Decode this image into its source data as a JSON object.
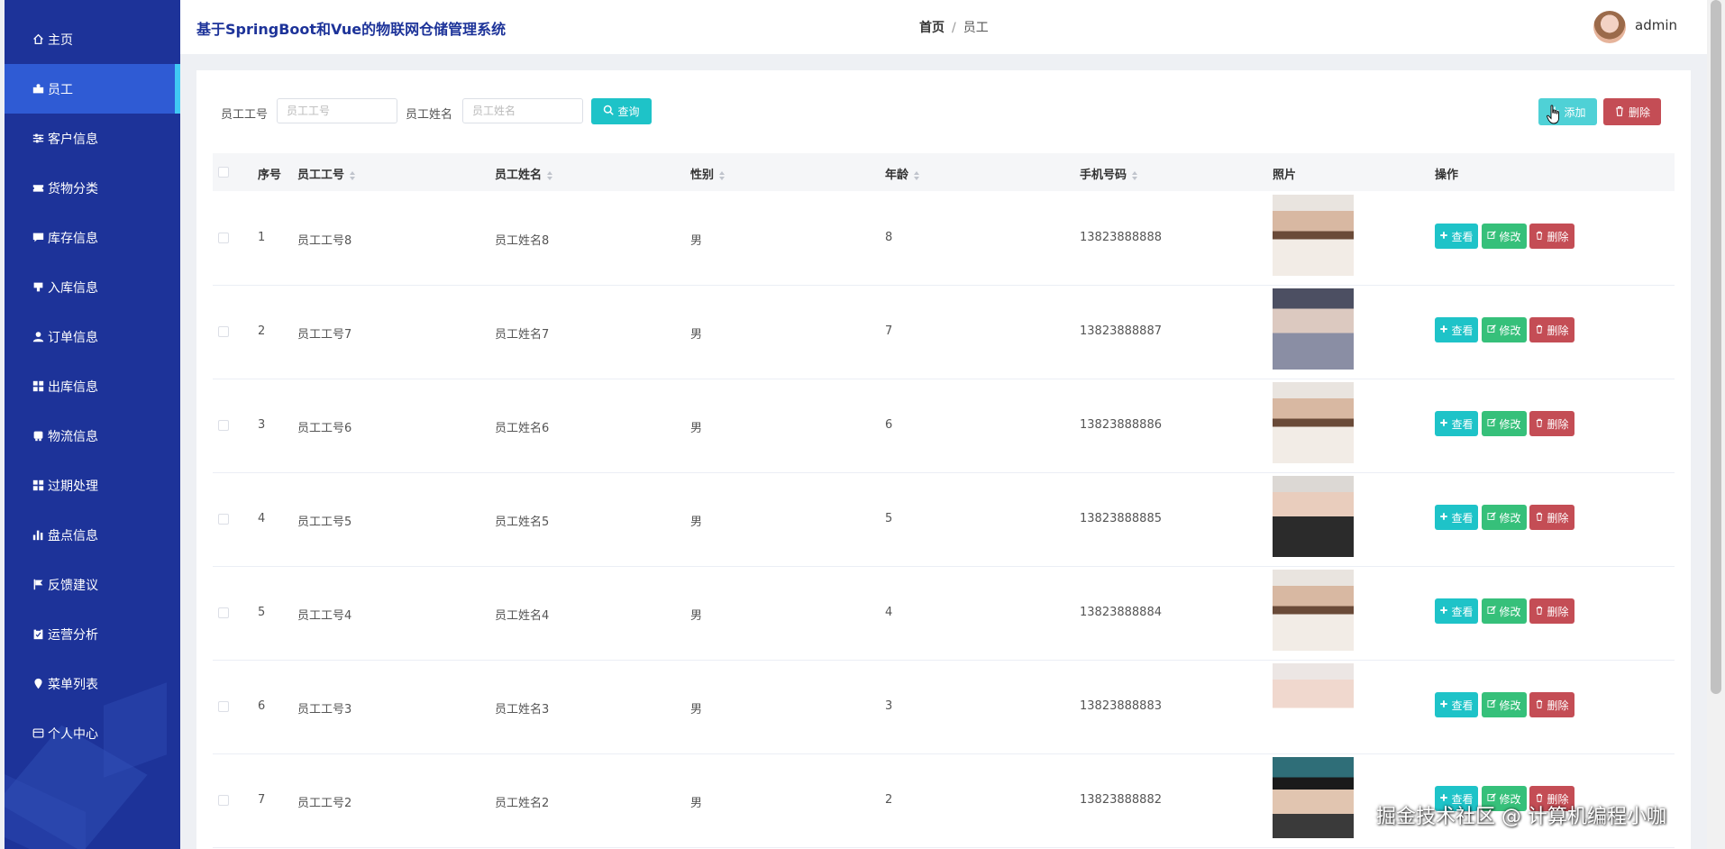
{
  "header": {
    "title": "基于SpringBoot和Vue的物联网仓储管理系统",
    "breadcrumb_home": "首页",
    "breadcrumb_separator": "/",
    "breadcrumb_current": "员工",
    "username": "admin"
  },
  "sidebar": {
    "items": [
      {
        "label": "主页",
        "icon": "home-icon"
      },
      {
        "label": "员工",
        "icon": "user-card-icon"
      },
      {
        "label": "客户信息",
        "icon": "sliders-icon"
      },
      {
        "label": "货物分类",
        "icon": "ticket-icon"
      },
      {
        "label": "库存信息",
        "icon": "chat-icon"
      },
      {
        "label": "入库信息",
        "icon": "inbox-icon"
      },
      {
        "label": "订单信息",
        "icon": "person-icon"
      },
      {
        "label": "出库信息",
        "icon": "grid-icon"
      },
      {
        "label": "物流信息",
        "icon": "truck-icon"
      },
      {
        "label": "过期处理",
        "icon": "grid-icon"
      },
      {
        "label": "盘点信息",
        "icon": "bar-chart-icon"
      },
      {
        "label": "反馈建议",
        "icon": "flag-icon"
      },
      {
        "label": "运营分析",
        "icon": "clipboard-icon"
      },
      {
        "label": "菜单列表",
        "icon": "pin-icon"
      },
      {
        "label": "个人中心",
        "icon": "id-card-icon"
      }
    ],
    "active_index": 1
  },
  "search": {
    "employee_no_label": "员工工号",
    "employee_no_placeholder": "员工工号",
    "employee_name_label": "员工姓名",
    "employee_name_placeholder": "员工姓名",
    "query_label": "查询"
  },
  "toolbar": {
    "add_label": "添加",
    "delete_label": "删除"
  },
  "table": {
    "columns": [
      "序号",
      "员工工号",
      "员工姓名",
      "性别",
      "年龄",
      "手机号码",
      "照片",
      "操作"
    ],
    "action_labels": {
      "view": "查看",
      "edit": "修改",
      "delete": "删除"
    },
    "rows": [
      {
        "index": "1",
        "employee_no": "员工工号8",
        "name": "员工姓名8",
        "gender": "男",
        "age": "8",
        "phone": "13823888888"
      },
      {
        "index": "2",
        "employee_no": "员工工号7",
        "name": "员工姓名7",
        "gender": "男",
        "age": "7",
        "phone": "13823888887"
      },
      {
        "index": "3",
        "employee_no": "员工工号6",
        "name": "员工姓名6",
        "gender": "男",
        "age": "6",
        "phone": "13823888886"
      },
      {
        "index": "4",
        "employee_no": "员工工号5",
        "name": "员工姓名5",
        "gender": "男",
        "age": "5",
        "phone": "13823888885"
      },
      {
        "index": "5",
        "employee_no": "员工工号4",
        "name": "员工姓名4",
        "gender": "男",
        "age": "4",
        "phone": "13823888884"
      },
      {
        "index": "6",
        "employee_no": "员工工号3",
        "name": "员工姓名3",
        "gender": "男",
        "age": "3",
        "phone": "13823888883"
      },
      {
        "index": "7",
        "employee_no": "员工工号2",
        "name": "员工姓名2",
        "gender": "男",
        "age": "2",
        "phone": "13823888882"
      }
    ]
  },
  "watermark": "掘金技术社区 @ 计算机编程小咖",
  "colors": {
    "sidebar_bg": "#1d3399",
    "sidebar_active": "#2f5bd4",
    "active_indicator": "#40c9f4",
    "teal": "#1ec3c8",
    "green": "#36c07a",
    "red": "#c44d55"
  }
}
